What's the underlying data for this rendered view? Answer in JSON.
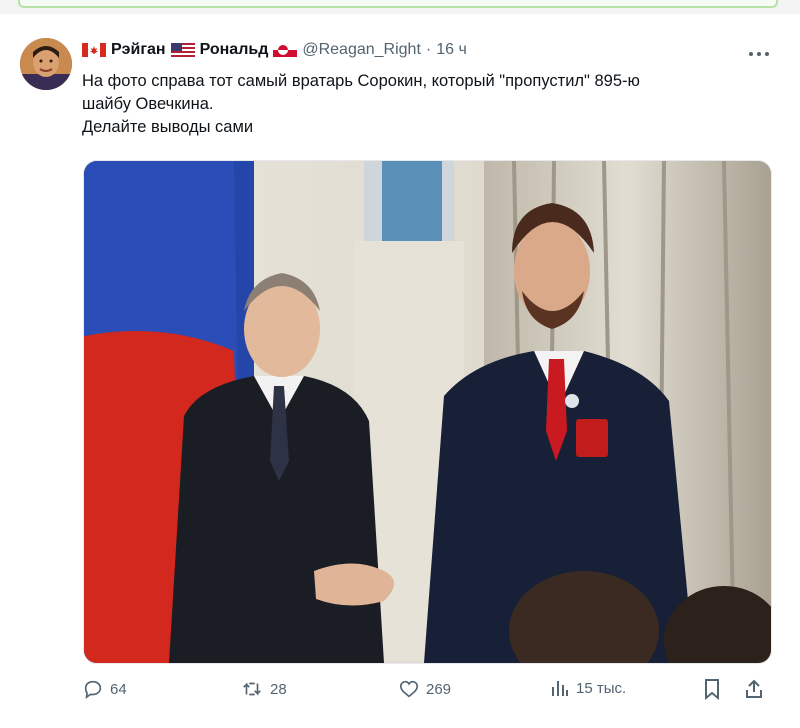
{
  "author": {
    "name_part1": "Рэйган",
    "name_part2": "Рональд",
    "handle": "@Reagan_Right",
    "separator": "·",
    "time": "16 ч",
    "flags": [
      "canada-flag-icon",
      "usa-flag-icon",
      "greenland-flag-icon"
    ]
  },
  "tweet": {
    "line1": "На фото справа тот самый вратарь Сорокин, который \"пропустил\" 895-ю",
    "line2": "шайбу Овечкина.",
    "line3": "Делайте выводы сами"
  },
  "actions": {
    "replies": "64",
    "retweets": "28",
    "likes": "269",
    "views": "15 тыс."
  },
  "colors": {
    "text": "#0f1419",
    "muted": "#536471",
    "accent_bar": "#b7e1a6"
  }
}
